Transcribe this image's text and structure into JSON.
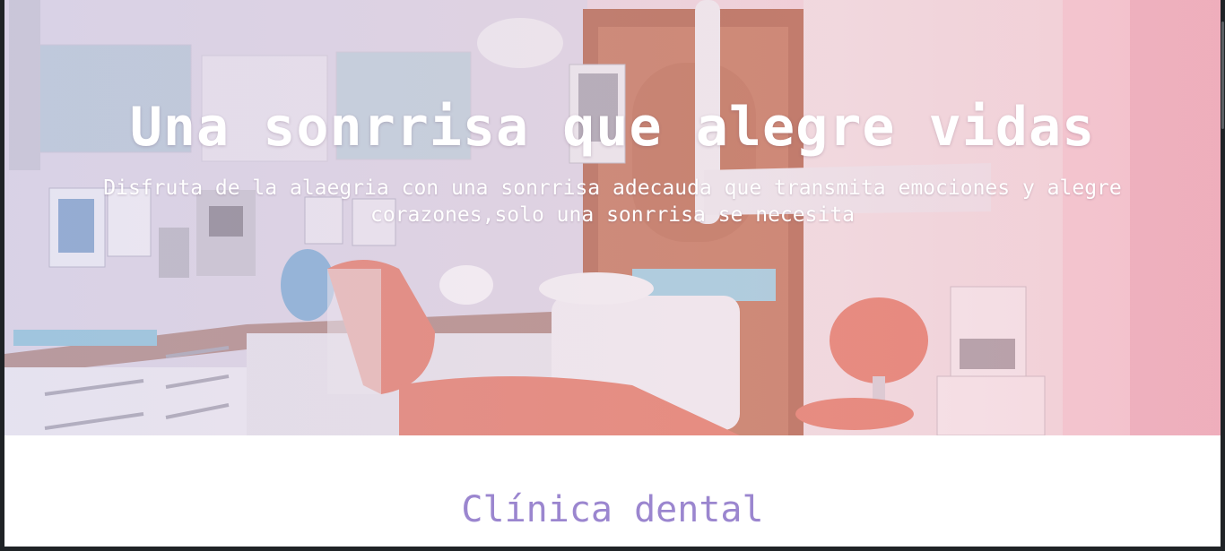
{
  "hero": {
    "title": "Una sonrrisa que alegre vidas",
    "subtitle": "Disfruta de la alaegria con una sonrrisa adecauda que transmita emociones y alegre corazones,solo una sonrrisa se necesita"
  },
  "section": {
    "title": "Clínica dental"
  },
  "colors": {
    "section_title": "#9b86cf",
    "hero_text": "#ffffff",
    "chair": "#e47f6c"
  }
}
